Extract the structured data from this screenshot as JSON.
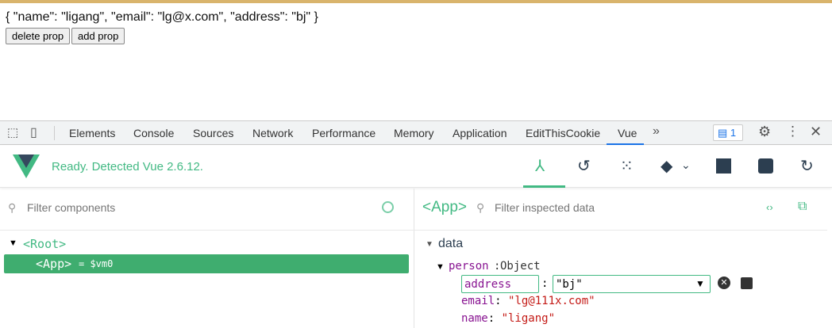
{
  "page": {
    "json_text": "{ \"name\": \"ligang\", \"email\": \"lg@x.com\", \"address\": \"bj\" }",
    "delete_label": "delete prop",
    "add_label": "add prop"
  },
  "devtools": {
    "tabs": [
      "Elements",
      "Console",
      "Sources",
      "Network",
      "Performance",
      "Memory",
      "Application",
      "EditThisCookie",
      "Vue"
    ],
    "active_tab": "Vue",
    "more": "»",
    "issues_count": "1"
  },
  "vue": {
    "status": "Ready. Detected Vue 2.6.12.",
    "accent": "#42b983"
  },
  "components": {
    "filter_placeholder": "Filter components",
    "root": "<Root>",
    "app": "<App>",
    "app_ref": "= $vm0"
  },
  "inspector": {
    "component": "<App>",
    "filter_placeholder": "Filter inspected data",
    "section": "data",
    "object_key": "person",
    "object_type": "Object",
    "edit_key": "address",
    "edit_value": "\"bj\"",
    "props": [
      {
        "key": "email",
        "value": "\"lg@111x.com\""
      },
      {
        "key": "name",
        "value": "\"ligang\""
      }
    ]
  }
}
